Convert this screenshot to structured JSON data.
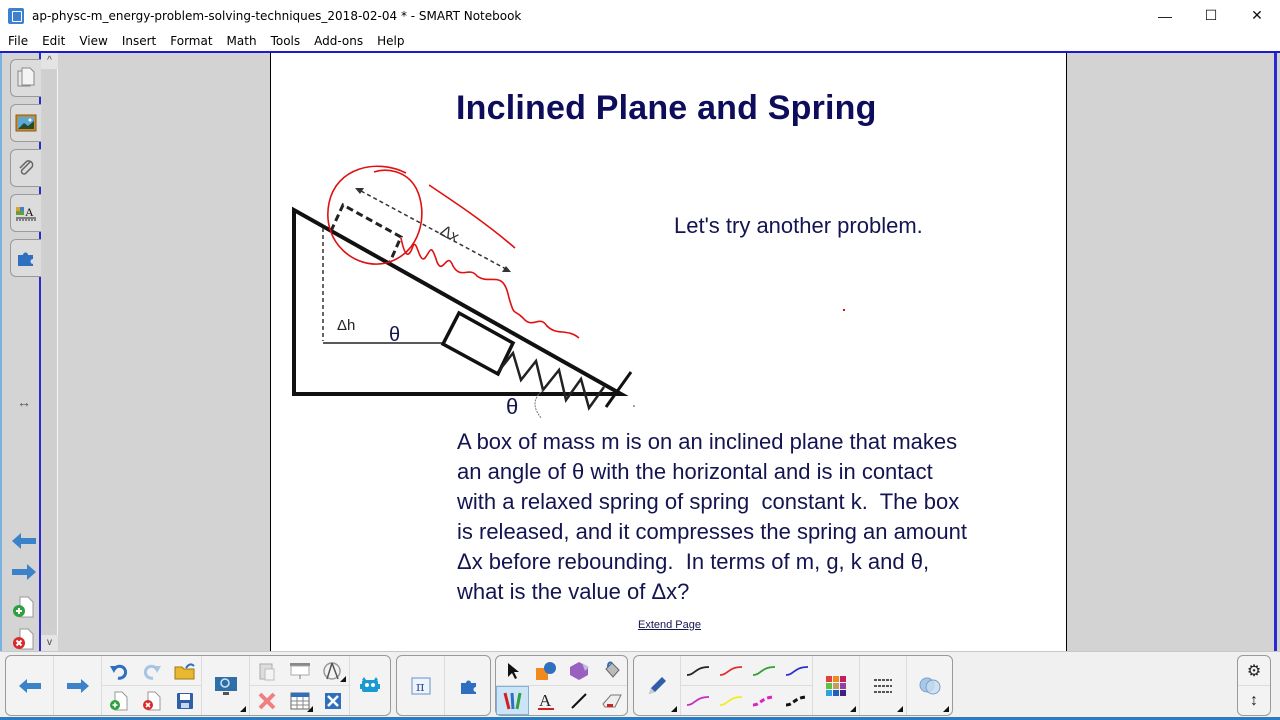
{
  "window": {
    "title": "ap-physc-m_energy-problem-solving-techniques_2018-02-04 * - SMART Notebook",
    "app_icon": "smart-notebook-icon",
    "controls": {
      "minimize": "—",
      "maximize": "☐",
      "close": "✕"
    }
  },
  "menu": {
    "items": [
      "File",
      "Edit",
      "View",
      "Insert",
      "Format",
      "Math",
      "Tools",
      "Add-ons",
      "Help"
    ]
  },
  "sidebar": {
    "tabs": [
      {
        "name": "page-sorter",
        "icon": "pages-icon"
      },
      {
        "name": "gallery",
        "icon": "picture-icon"
      },
      {
        "name": "attachments",
        "icon": "paperclip-icon"
      },
      {
        "name": "properties",
        "icon": "properties-icon"
      },
      {
        "name": "add-ons",
        "icon": "puzzle-icon"
      }
    ],
    "resize_glyph": "↔",
    "nav": [
      {
        "name": "previous-page",
        "icon": "arrow-left-icon"
      },
      {
        "name": "next-page",
        "icon": "arrow-right-icon"
      },
      {
        "name": "add-page",
        "icon": "add-page-icon"
      },
      {
        "name": "delete-page",
        "icon": "delete-page-icon"
      }
    ]
  },
  "scrollbar": {
    "up": "^",
    "down": "v"
  },
  "slide": {
    "title": "Inclined Plane and Spring",
    "intro": "Let's try another problem.",
    "problem_lines": [
      "A box of mass m is on an inclined plane that makes",
      "an angle of θ with the horizontal and is in contact",
      "with a relaxed spring of spring  constant k.  The box",
      "is released, and it compresses the spring an amount",
      "Δx before rebounding.  In terms of m, g, k and θ,",
      "what is the value of Δx?"
    ],
    "extend_page": "Extend Page",
    "diagram": {
      "label_dx": "Δx",
      "label_dh": "Δh",
      "label_theta_top": "θ",
      "label_theta_bottom": "θ",
      "ink_color": "#e01010",
      "text_color": "#141450"
    }
  },
  "toolbar": {
    "nav": [
      "previous-page",
      "next-page"
    ],
    "file": [
      "undo",
      "redo",
      "open-file",
      "add-page",
      "delete-page",
      "save"
    ],
    "display": [
      "screen-shade"
    ],
    "edit": [
      "paste",
      "show-hide-screen-shade",
      "measurement-tools",
      "delete",
      "insert-table",
      "smart-response"
    ],
    "extra": [
      "lab-monster"
    ],
    "math": [
      "math-tools",
      "add-ons"
    ],
    "tools": [
      "select",
      "shapes",
      "regular-polygons",
      "fill",
      "pens",
      "text",
      "lines",
      "eraser"
    ],
    "pen_styles": [
      "black",
      "red",
      "green",
      "blue",
      "magenta",
      "yellow",
      "magenta-dashed",
      "black-dashed"
    ],
    "pen_colors": [
      "#222222",
      "#e03030",
      "#30a030",
      "#3030d0",
      "#c030c0",
      "#f0f020",
      "#e020c0",
      "#111111"
    ],
    "right": [
      "settings",
      "move-toolbar"
    ],
    "accent": "#2a7bc0"
  }
}
